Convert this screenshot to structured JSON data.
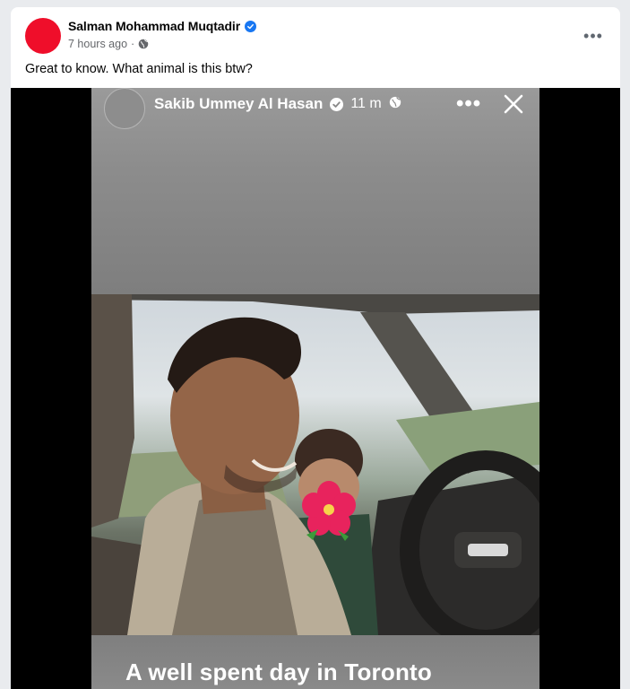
{
  "post": {
    "author": "Salman Mohammad Muqtadir",
    "avatar_color": "#ef0e2a",
    "time": "7 hours ago",
    "separator": "·",
    "audience_icon": "globe-icon",
    "more_icon": "more-options-icon",
    "text": "Great to know. What animal is this btw?"
  },
  "story": {
    "author": "Sakib Ummey Al Hasan",
    "time": "11 m",
    "audience_icon": "globe-icon",
    "caption": "A well spent day in Toronto",
    "sticker_icon": "hibiscus-flower-icon",
    "more_icon": "more-options-icon",
    "close_icon": "close-icon"
  },
  "colors": {
    "verified": "#1877f2",
    "meta_text": "#65676b"
  }
}
